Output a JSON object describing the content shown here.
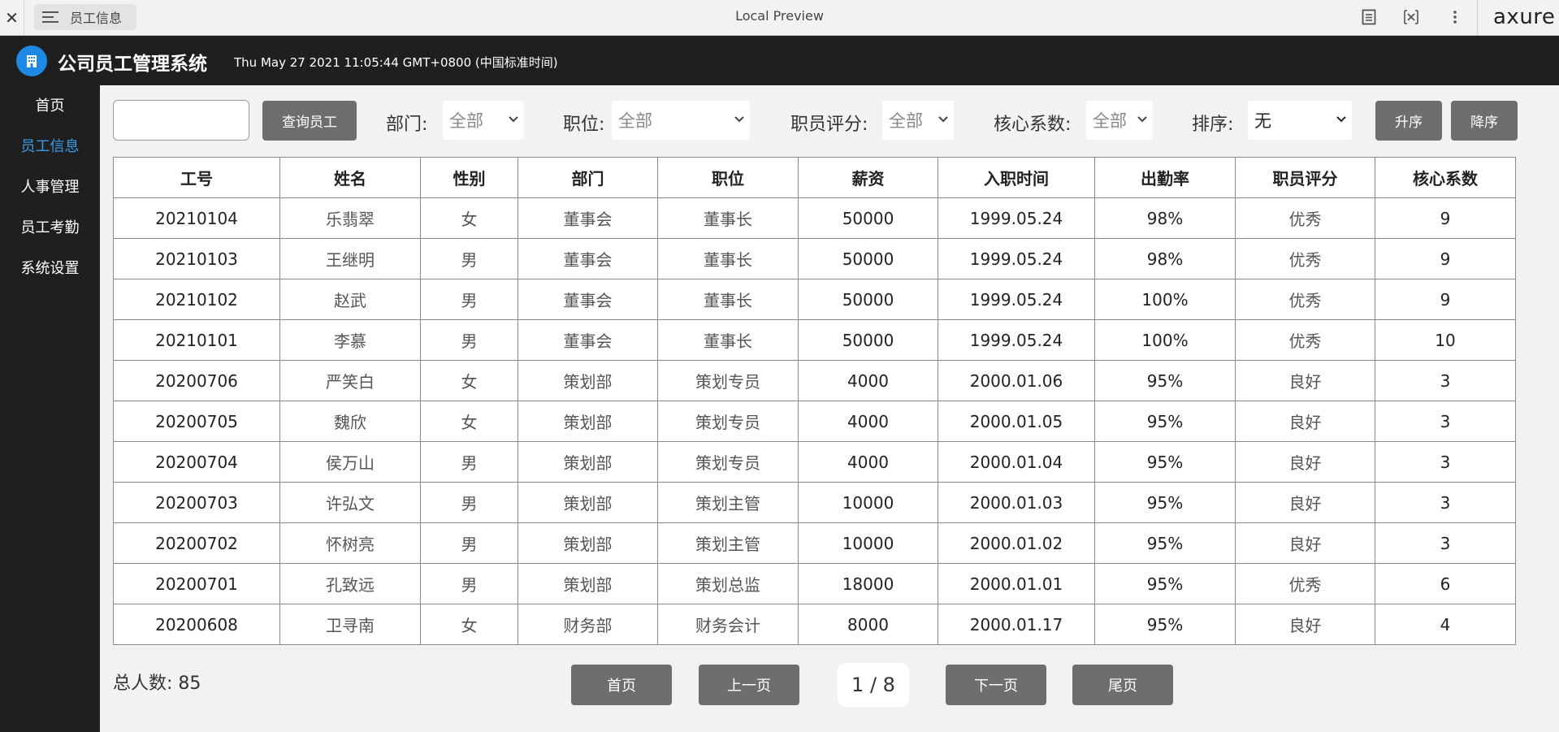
{
  "preview_bar": {
    "close_glyph": "✕",
    "page_name": "员工信息",
    "title": "Local Preview",
    "brand": "axure"
  },
  "app": {
    "title": "公司员工管理系统",
    "datetime": "Thu May 27 2021 11:05:44 GMT+0800 (中国标准时间)"
  },
  "sidebar": {
    "items": [
      {
        "label": "首页"
      },
      {
        "label": "员工信息"
      },
      {
        "label": "人事管理"
      },
      {
        "label": "员工考勤"
      },
      {
        "label": "系统设置"
      }
    ]
  },
  "filters": {
    "search_value": "",
    "search_button": "查询员工",
    "department_label": "部门:",
    "department_value": "全部",
    "position_label": "职位:",
    "position_value": "全部",
    "rating_label": "职员评分:",
    "rating_value": "全部",
    "core_label": "核心系数:",
    "core_value": "全部",
    "sort_label": "排序:",
    "sort_value": "无",
    "asc_button": "升序",
    "desc_button": "降序"
  },
  "table": {
    "headers": [
      "工号",
      "姓名",
      "性别",
      "部门",
      "职位",
      "薪资",
      "入职时间",
      "出勤率",
      "职员评分",
      "核心系数"
    ],
    "rows": [
      [
        "20210104",
        "乐翡翠",
        "女",
        "董事会",
        "董事长",
        "50000",
        "1999.05.24",
        "98%",
        "优秀",
        "9"
      ],
      [
        "20210103",
        "王继明",
        "男",
        "董事会",
        "董事长",
        "50000",
        "1999.05.24",
        "98%",
        "优秀",
        "9"
      ],
      [
        "20210102",
        "赵武",
        "男",
        "董事会",
        "董事长",
        "50000",
        "1999.05.24",
        "100%",
        "优秀",
        "9"
      ],
      [
        "20210101",
        "李慕",
        "男",
        "董事会",
        "董事长",
        "50000",
        "1999.05.24",
        "100%",
        "优秀",
        "10"
      ],
      [
        "20200706",
        "严笑白",
        "女",
        "策划部",
        "策划专员",
        "4000",
        "2000.01.06",
        "95%",
        "良好",
        "3"
      ],
      [
        "20200705",
        "魏欣",
        "女",
        "策划部",
        "策划专员",
        "4000",
        "2000.01.05",
        "95%",
        "良好",
        "3"
      ],
      [
        "20200704",
        "侯万山",
        "男",
        "策划部",
        "策划专员",
        "4000",
        "2000.01.04",
        "95%",
        "良好",
        "3"
      ],
      [
        "20200703",
        "许弘文",
        "男",
        "策划部",
        "策划主管",
        "10000",
        "2000.01.03",
        "95%",
        "良好",
        "3"
      ],
      [
        "20200702",
        "怀树亮",
        "男",
        "策划部",
        "策划主管",
        "10000",
        "2000.01.02",
        "95%",
        "良好",
        "3"
      ],
      [
        "20200701",
        "孔致远",
        "男",
        "策划部",
        "策划总监",
        "18000",
        "2000.01.01",
        "95%",
        "优秀",
        "6"
      ],
      [
        "20200608",
        "卫寻南",
        "女",
        "财务部",
        "财务会计",
        "8000",
        "2000.01.17",
        "95%",
        "良好",
        "4"
      ]
    ]
  },
  "footer": {
    "total_label": "总人数:",
    "total_count": "85",
    "first_button": "首页",
    "prev_button": "上一页",
    "page_indicator": "1 / 8",
    "next_button": "下一页",
    "last_button": "尾页"
  },
  "colors": {
    "accent": "#3a9be8",
    "logo": "#1e88e5",
    "header_bg": "#1f1f1f",
    "button_bg": "#6e6e6e"
  }
}
